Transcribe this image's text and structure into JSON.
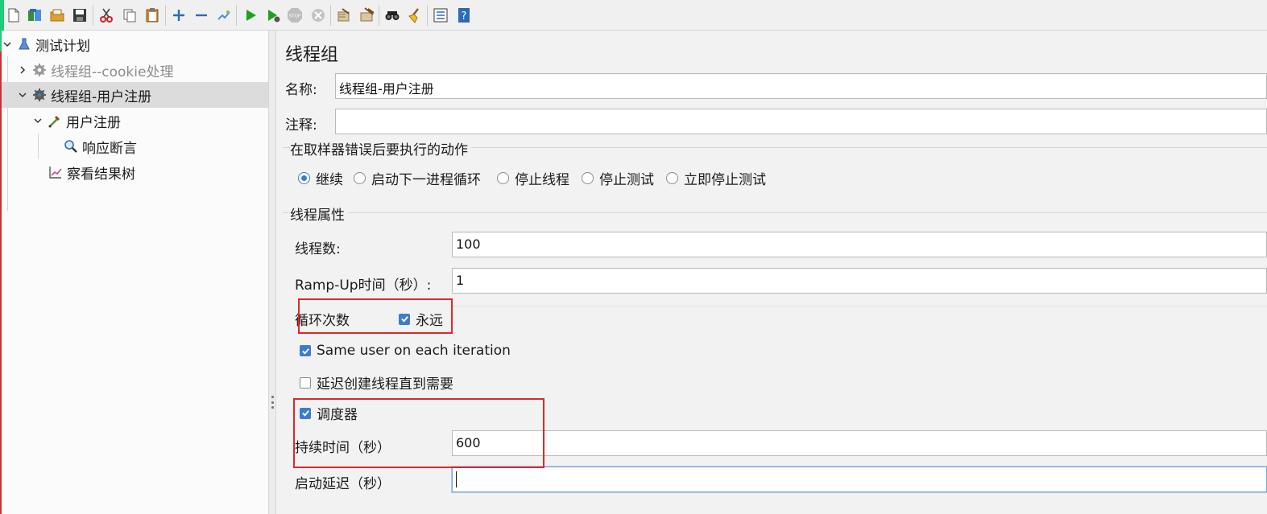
{
  "toolbar": {
    "items": [
      "new-icon",
      "templates-icon",
      "open-icon",
      "save-icon",
      "cut-icon",
      "copy-icon",
      "paste-icon",
      "expand-icon",
      "collapse-icon",
      "toggle-icon",
      "start-icon",
      "start-no-pause-icon",
      "stop-icon",
      "shutdown-icon",
      "clear-icon",
      "clear-all-icon",
      "search-icon",
      "reset-search-icon",
      "function-helper-icon",
      "help-icon"
    ]
  },
  "tree": {
    "items": [
      {
        "label": "测试计划",
        "icon": "test-plan-icon",
        "expanded": true
      },
      {
        "label": "线程组--cookie处理",
        "icon": "gear-icon",
        "expanded": false,
        "disabled": true
      },
      {
        "label": "线程组-用户注册",
        "icon": "gear-icon",
        "expanded": true,
        "selected": true
      },
      {
        "label": "用户注册",
        "icon": "sampler-icon",
        "expanded": true
      },
      {
        "label": "响应断言",
        "icon": "assertion-icon"
      },
      {
        "label": "察看结果树",
        "icon": "listener-icon"
      }
    ]
  },
  "panel": {
    "title": "线程组",
    "name_label": "名称:",
    "name_value": "线程组-用户注册",
    "comment_label": "注释:",
    "comment_value": "",
    "error_action_title": "在取样器错误后要执行的动作",
    "error_actions": [
      {
        "label": "继续",
        "selected": true
      },
      {
        "label": "启动下一进程循环",
        "selected": false
      },
      {
        "label": "停止线程",
        "selected": false
      },
      {
        "label": "停止测试",
        "selected": false
      },
      {
        "label": "立即停止测试",
        "selected": false
      }
    ],
    "thread_props_title": "线程属性",
    "threads_label": "线程数:",
    "threads_value": "100",
    "rampup_label": "Ramp-Up时间（秒）:",
    "rampup_value": "1",
    "loop_label": "循环次数",
    "forever_label": "永远",
    "forever_checked": true,
    "same_user_label": "Same user on each iteration",
    "same_user_checked": true,
    "delay_label": "延迟创建线程直到需要",
    "delay_checked": false,
    "scheduler_label": "调度器",
    "scheduler_checked": true,
    "duration_label": "持续时间（秒）",
    "duration_value": "600",
    "startup_delay_label": "启动延迟（秒）",
    "startup_delay_value": ""
  },
  "colors": {
    "highlight_box": "#e0262b",
    "checkbox_accent": "#3e7cc8",
    "selected_row": "#dcdcdc"
  }
}
